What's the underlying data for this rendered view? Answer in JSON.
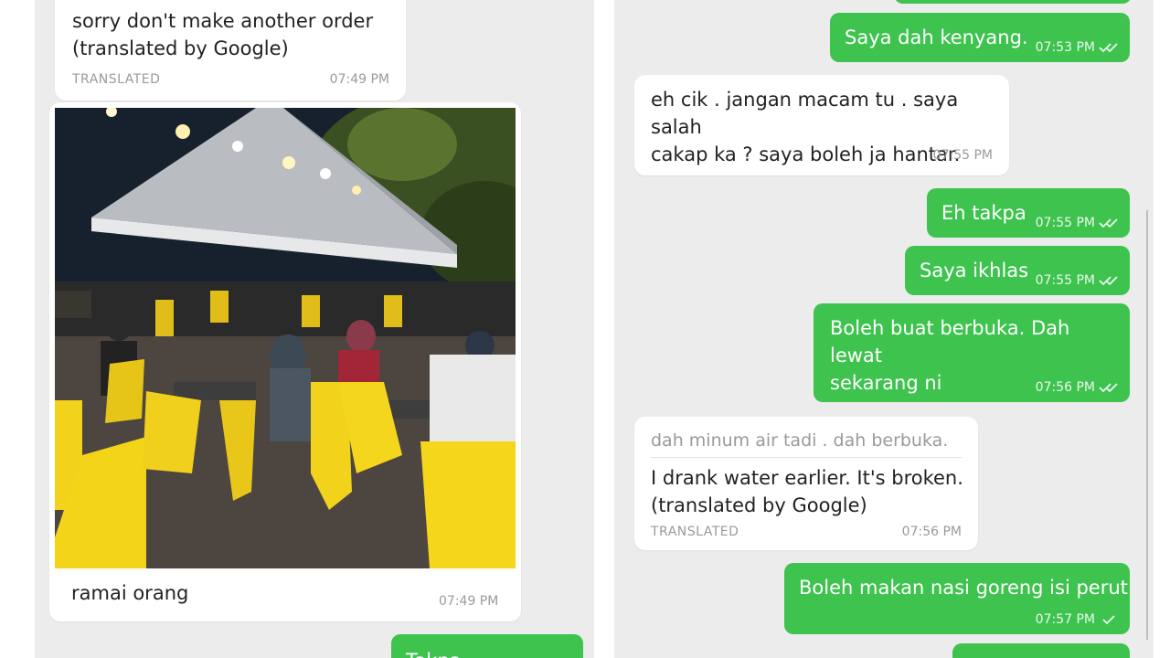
{
  "left": {
    "msg_translated_top": {
      "text": "sorry don't make another order\n(translated by Google)",
      "tag": "TRANSLATED",
      "time": "07:49 PM"
    },
    "photo_msg": {
      "caption": "ramai orang",
      "time": "07:49 PM"
    },
    "partial_out": {
      "text": "Takpa"
    }
  },
  "right": {
    "messages": [
      {
        "text": "Saya dah kenyang.",
        "time": "07:53 PM",
        "ticks": "double"
      },
      {
        "text": "eh cik . jangan macam tu . saya salah\ncakap ka ? saya boleh ja hantar.",
        "time": "07:55 PM"
      },
      {
        "text": "Eh takpa",
        "time": "07:55 PM",
        "ticks": "double"
      },
      {
        "text": "Saya ikhlas",
        "time": "07:55 PM",
        "ticks": "double"
      },
      {
        "text": "Boleh buat berbuka. Dah lewat\nsekarang ni",
        "time": "07:56 PM",
        "ticks": "double"
      },
      {
        "original": "dah minum air tadi . dah berbuka.",
        "text": "I drank water earlier. It's broken.\n(translated by Google)",
        "tag": "TRANSLATED",
        "time": "07:56 PM"
      },
      {
        "text": "Boleh makan nasi goreng isi perut",
        "time": "07:57 PM",
        "ticks": "single"
      }
    ]
  },
  "colors": {
    "outgoing_bubble": "#3ec34f",
    "incoming_bubble": "#ffffff",
    "background": "#ececec"
  }
}
